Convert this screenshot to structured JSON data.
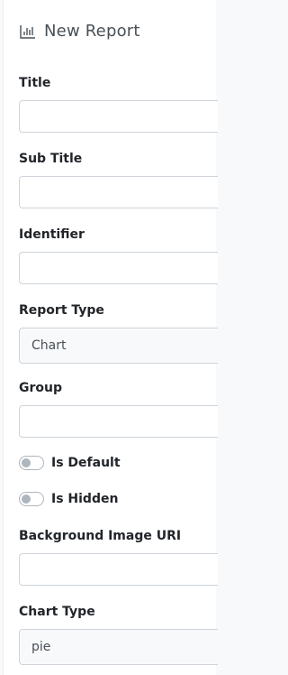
{
  "header": {
    "title": "New Report",
    "icon": "bar-chart-icon"
  },
  "fields": {
    "title": {
      "label": "Title",
      "value": ""
    },
    "sub_title": {
      "label": "Sub Title",
      "value": ""
    },
    "identifier": {
      "label": "Identifier",
      "value": ""
    },
    "report_type": {
      "label": "Report Type",
      "value": "Chart"
    },
    "group": {
      "label": "Group",
      "value": ""
    },
    "background_image_uri": {
      "label": "Background Image URI",
      "value": ""
    },
    "chart_type": {
      "label": "Chart Type",
      "value": "pie"
    }
  },
  "toggles": {
    "is_default": {
      "label": "Is Default",
      "checked": false
    },
    "is_hidden": {
      "label": "Is Hidden",
      "checked": false
    }
  },
  "colors": {
    "border": "#ced4da",
    "switch_off": "#adb5bd",
    "text": "#212529"
  }
}
